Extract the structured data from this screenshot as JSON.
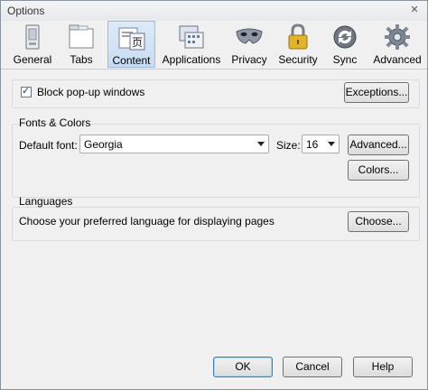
{
  "window": {
    "title": "Options",
    "close_glyph": "✕"
  },
  "toolbar": {
    "tabs": [
      {
        "label": "General",
        "icon": "general-icon"
      },
      {
        "label": "Tabs",
        "icon": "tabs-icon"
      },
      {
        "label": "Content",
        "icon": "content-icon",
        "selected": true
      },
      {
        "label": "Applications",
        "icon": "applications-icon"
      },
      {
        "label": "Privacy",
        "icon": "privacy-mask-icon"
      },
      {
        "label": "Security",
        "icon": "padlock-icon"
      },
      {
        "label": "Sync",
        "icon": "sync-icon"
      },
      {
        "label": "Advanced",
        "icon": "gear-icon"
      }
    ]
  },
  "content": {
    "popup": {
      "label": "Block pop-up windows",
      "checked": true,
      "exceptions_button": "Exceptions..."
    },
    "fonts": {
      "legend": "Fonts & Colors",
      "default_font_label": "Default font:",
      "default_font_value": "Georgia",
      "size_label": "Size:",
      "size_value": "16",
      "advanced_button": "Advanced...",
      "colors_button": "Colors..."
    },
    "languages": {
      "legend": "Languages",
      "description": "Choose your preferred language for displaying pages",
      "choose_button": "Choose..."
    }
  },
  "footer": {
    "ok": "OK",
    "cancel": "Cancel",
    "help": "Help"
  }
}
